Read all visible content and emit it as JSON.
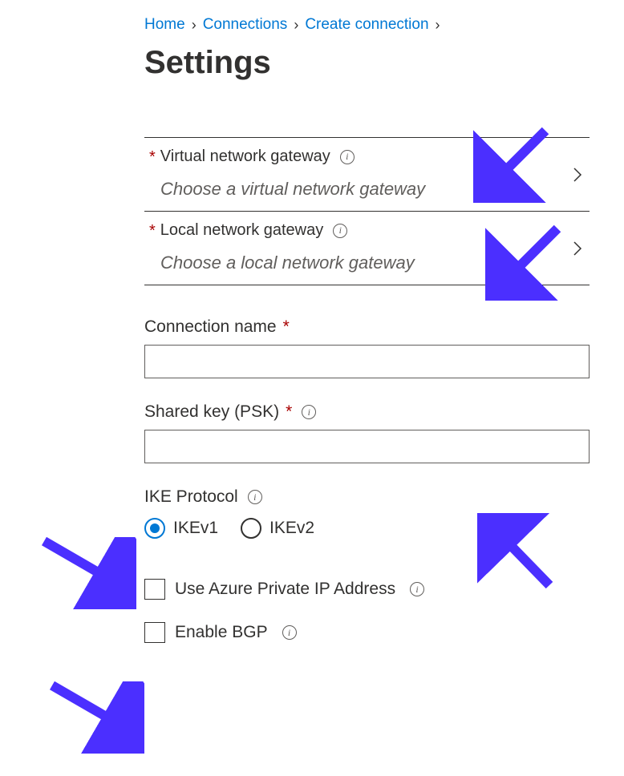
{
  "breadcrumb": {
    "items": [
      "Home",
      "Connections",
      "Create connection"
    ]
  },
  "page": {
    "title": "Settings"
  },
  "vng_picker": {
    "label": "Virtual network gateway",
    "placeholder": "Choose a virtual network gateway"
  },
  "lng_picker": {
    "label": "Local network gateway",
    "placeholder": "Choose a local network gateway"
  },
  "connection_name": {
    "label": "Connection name",
    "value": ""
  },
  "psk": {
    "label": "Shared key (PSK)",
    "value": ""
  },
  "ike": {
    "label": "IKE Protocol",
    "options": [
      "IKEv1",
      "IKEv2"
    ],
    "selected": "IKEv1"
  },
  "checkbox_private_ip": {
    "label": "Use Azure Private IP Address",
    "checked": false
  },
  "checkbox_bgp": {
    "label": "Enable BGP",
    "checked": false
  }
}
